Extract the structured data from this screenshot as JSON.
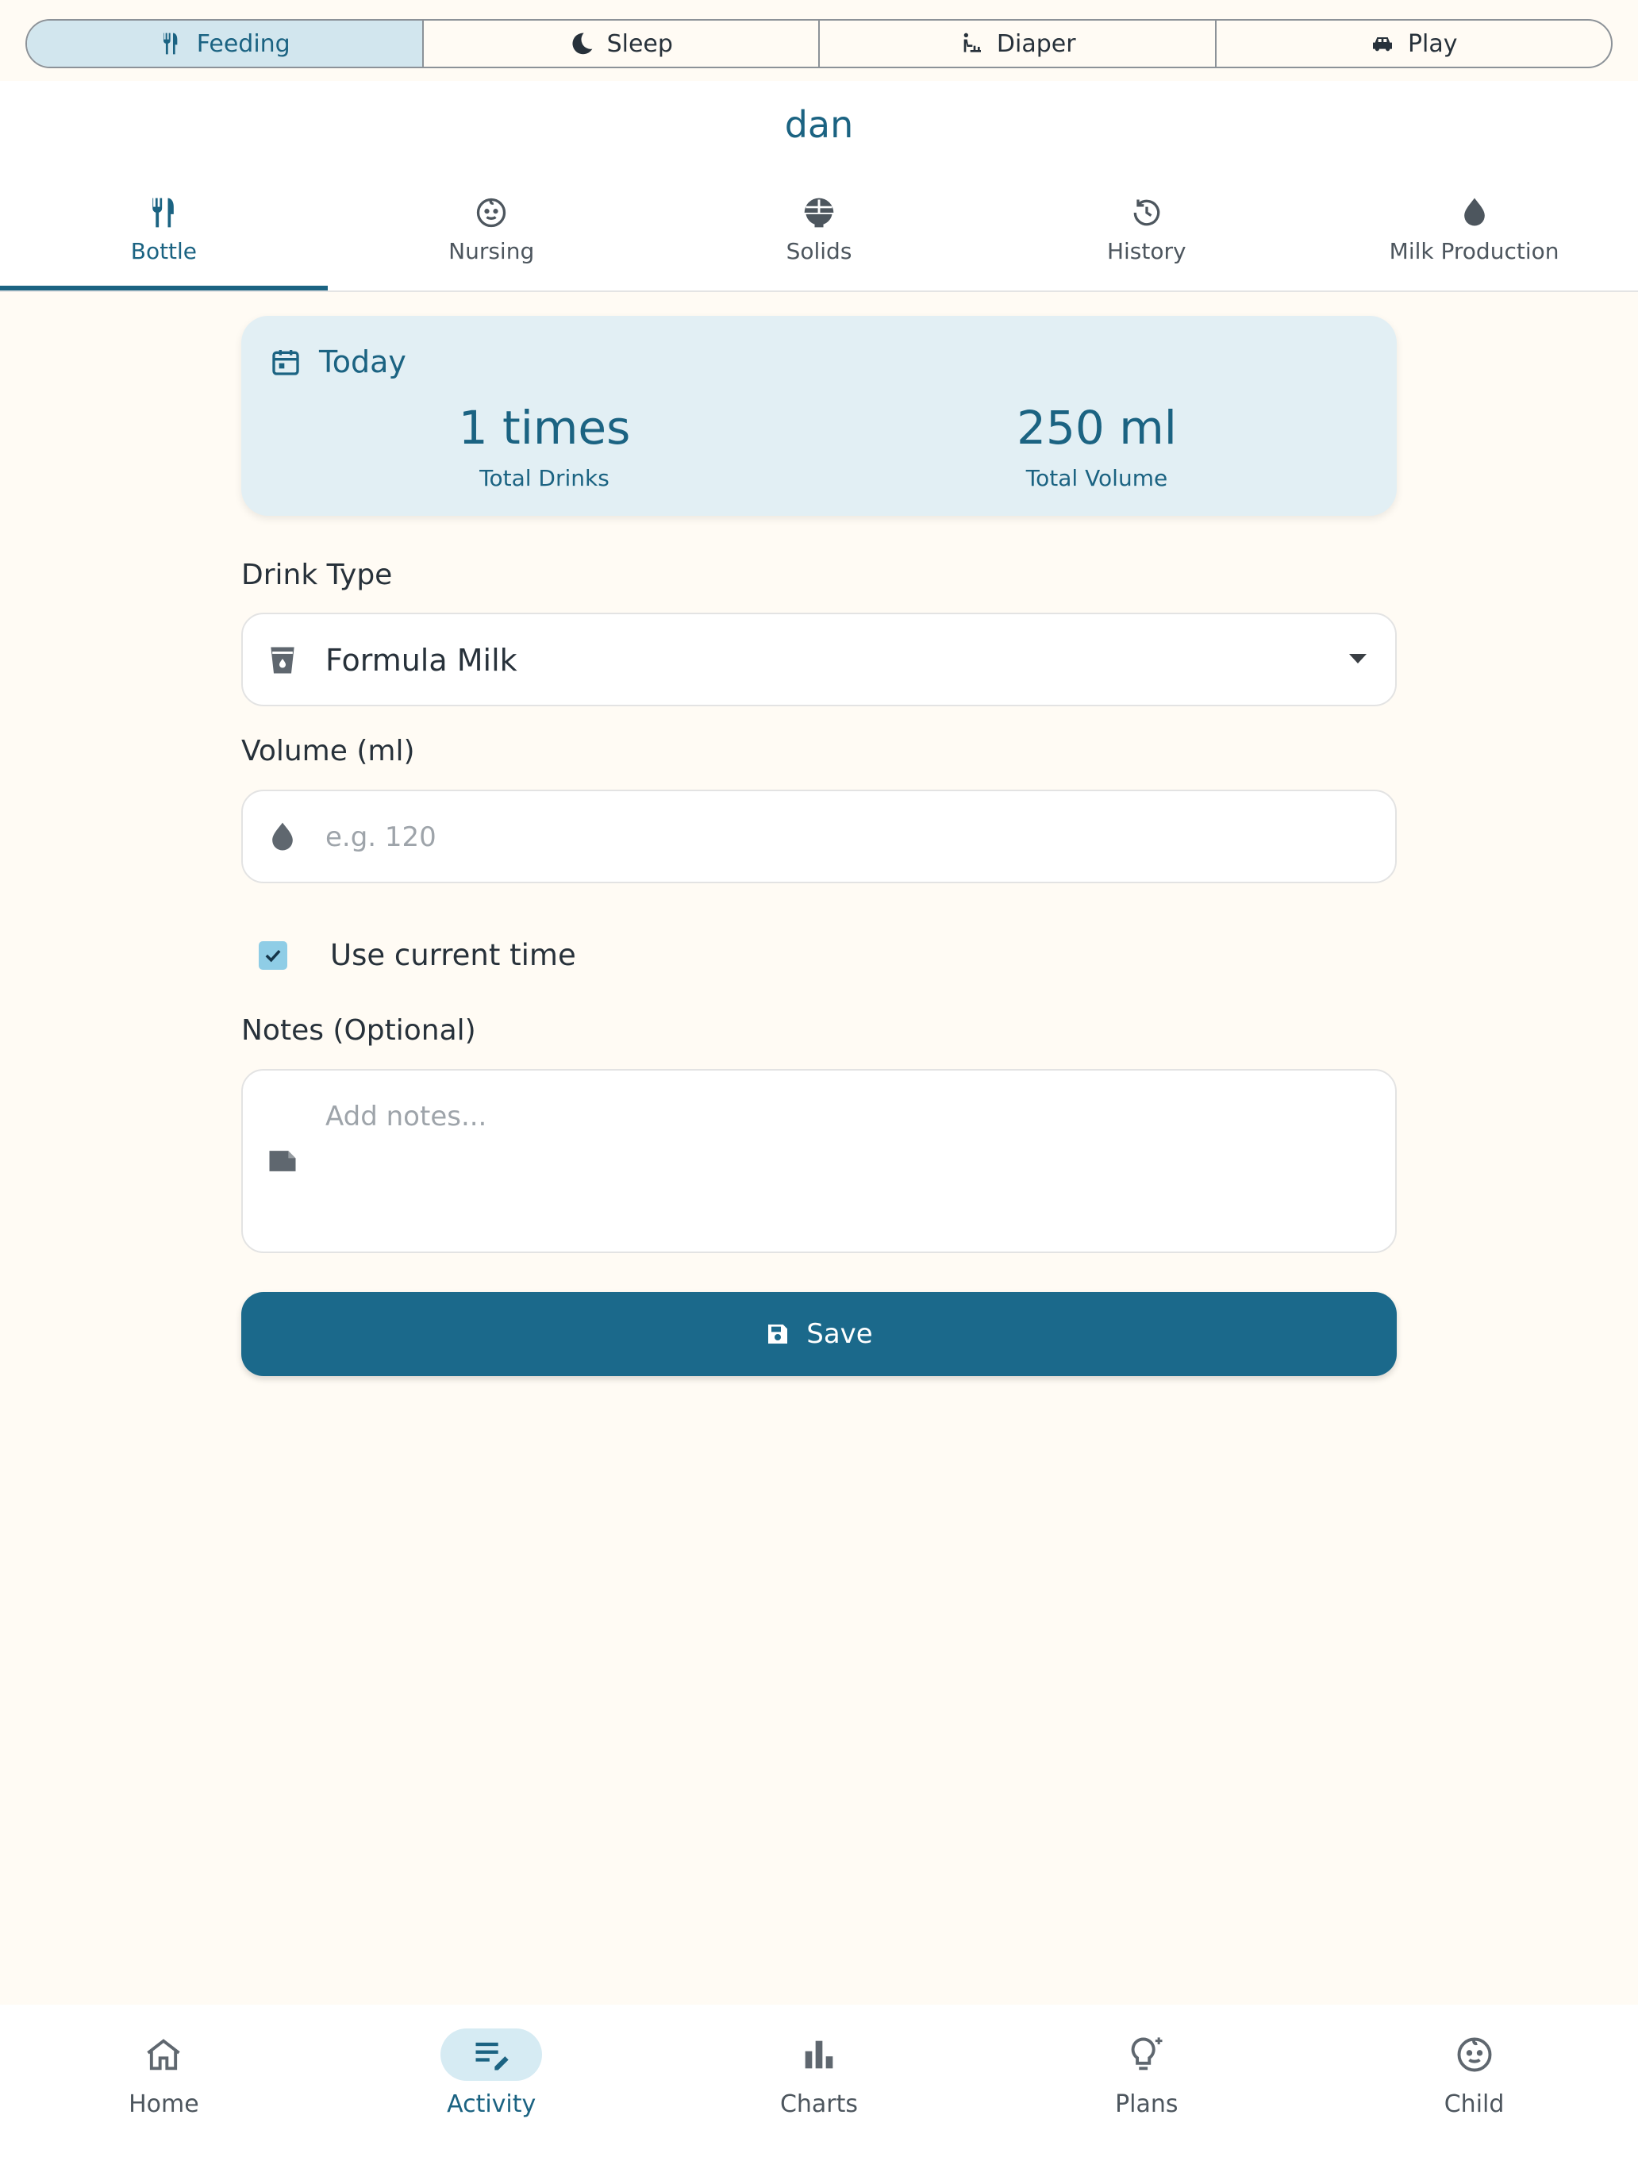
{
  "segments": [
    {
      "label": "Feeding",
      "icon": "utensils-icon",
      "active": true
    },
    {
      "label": "Sleep",
      "icon": "moon-icon",
      "active": false
    },
    {
      "label": "Diaper",
      "icon": "baby-changing-icon",
      "active": false
    },
    {
      "label": "Play",
      "icon": "toy-car-icon",
      "active": false
    }
  ],
  "child_name": "dan",
  "tabs": [
    {
      "label": "Bottle",
      "icon": "utensils-icon",
      "active": true
    },
    {
      "label": "Nursing",
      "icon": "baby-face-icon",
      "active": false
    },
    {
      "label": "Solids",
      "icon": "bowl-icon",
      "active": false
    },
    {
      "label": "History",
      "icon": "history-icon",
      "active": false
    },
    {
      "label": "Milk Production",
      "icon": "drop-icon",
      "active": false
    }
  ],
  "summary": {
    "title": "Today",
    "drinks_value": "1 times",
    "drinks_label": "Total Drinks",
    "volume_value": "250 ml",
    "volume_label": "Total Volume"
  },
  "form": {
    "drink_type_label": "Drink Type",
    "drink_type_value": "Formula Milk",
    "volume_label": "Volume (ml)",
    "volume_placeholder": "e.g. 120",
    "use_current_time_label": "Use current time",
    "use_current_time_checked": true,
    "notes_label": "Notes (Optional)",
    "notes_placeholder": "Add notes...",
    "save_label": "Save"
  },
  "bottom_nav": [
    {
      "label": "Home",
      "icon": "home-icon",
      "active": false
    },
    {
      "label": "Activity",
      "icon": "edit-list-icon",
      "active": true
    },
    {
      "label": "Charts",
      "icon": "bar-chart-icon",
      "active": false
    },
    {
      "label": "Plans",
      "icon": "lightbulb-icon",
      "active": false
    },
    {
      "label": "Child",
      "icon": "baby-face-icon",
      "active": false
    }
  ],
  "colors": {
    "primary": "#1b6382",
    "background": "#fffbf4",
    "active_segment": "#d2e6ee",
    "summary_card": "#e2eff4",
    "save_button": "#1b698b"
  }
}
